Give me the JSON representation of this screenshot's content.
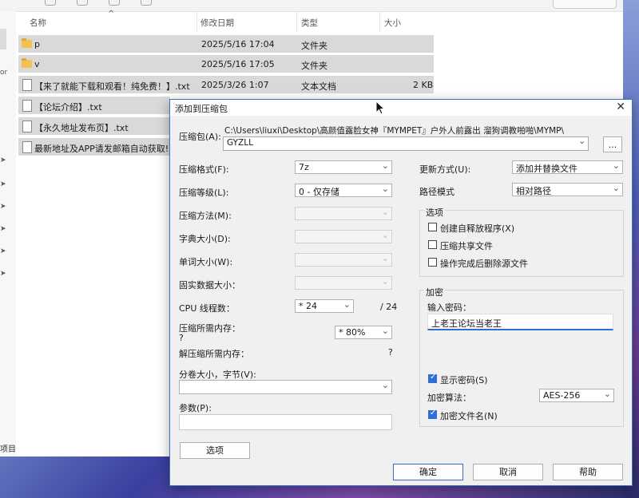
{
  "explorer": {
    "columns": {
      "name": "名称",
      "date": "修改日期",
      "type": "类型",
      "size": "大小"
    },
    "rows": [
      {
        "name": "p",
        "date": "2025/5/16 17:04",
        "type": "文件夹",
        "size": "",
        "icon": "folder-icon"
      },
      {
        "name": "v",
        "date": "2025/5/16 17:05",
        "type": "文件夹",
        "size": "",
        "icon": "folder-icon"
      },
      {
        "name": "【来了就能下载和观看！纯免费！】.txt",
        "date": "2025/3/26 1:07",
        "type": "文本文档",
        "size": "2 KB",
        "icon": "file-icon"
      },
      {
        "name": "【论坛介绍】.txt",
        "date": "",
        "type": "",
        "size": "",
        "icon": "file-icon"
      },
      {
        "name": "【永久地址发布页】.txt",
        "date": "",
        "type": "",
        "size": "",
        "icon": "file-icon"
      },
      {
        "name": "最新地址及APP请发邮箱自动获取!",
        "date": "",
        "type": "",
        "size": "",
        "icon": "file-icon"
      }
    ],
    "nav_fragment": "or",
    "bottom_fragment": "项目"
  },
  "dialog": {
    "title": "添加到压缩包",
    "archive_label": "压缩包(A):",
    "archive_path": "C:\\Users\\liuxi\\Desktop\\高颜值露脸女神『MYMPET』户外人前露出 溜狗调教啪啪\\MYMP\\",
    "archive_name": "GYZLL",
    "browse_label": "...",
    "left": {
      "format_label": "压缩格式(F):",
      "format_value": "7z",
      "level_label": "压缩等级(L):",
      "level_value": "0 - 仅存储",
      "method_label": "压缩方法(M):",
      "dict_label": "字典大小(D):",
      "word_label": "单词大小(W):",
      "solid_label": "固实数据大小：",
      "cpu_label": "CPU 线程数：",
      "cpu_value": "* 24",
      "cpu_max": "/ 24",
      "mem_label": "压缩所需内存：",
      "mem_q": "?",
      "mem_value": "* 80%",
      "demem_label": "解压缩所需内存：",
      "demem_q": "?",
      "split_label": "分卷大小，字节(V):",
      "params_label": "参数(P):",
      "options_button": "选项"
    },
    "right": {
      "update_label": "更新方式(U):",
      "update_value": "添加并替换文件",
      "path_label": "路径模式",
      "path_value": "相对路径",
      "options_title": "选项",
      "opt_sfx": "创建自释放程序(X)",
      "opt_shared": "压缩共享文件",
      "opt_delete": "操作完成后删除源文件",
      "enc_title": "加密",
      "pw_label": "输入密码：",
      "pw_value": "上老王论坛当老王",
      "show_pw": "显示密码(S)",
      "enc_method_label": "加密算法：",
      "enc_method_value": "AES-256",
      "enc_names": "加密文件名(N)"
    },
    "buttons": {
      "ok": "确定",
      "cancel": "取消",
      "help": "帮助"
    }
  }
}
